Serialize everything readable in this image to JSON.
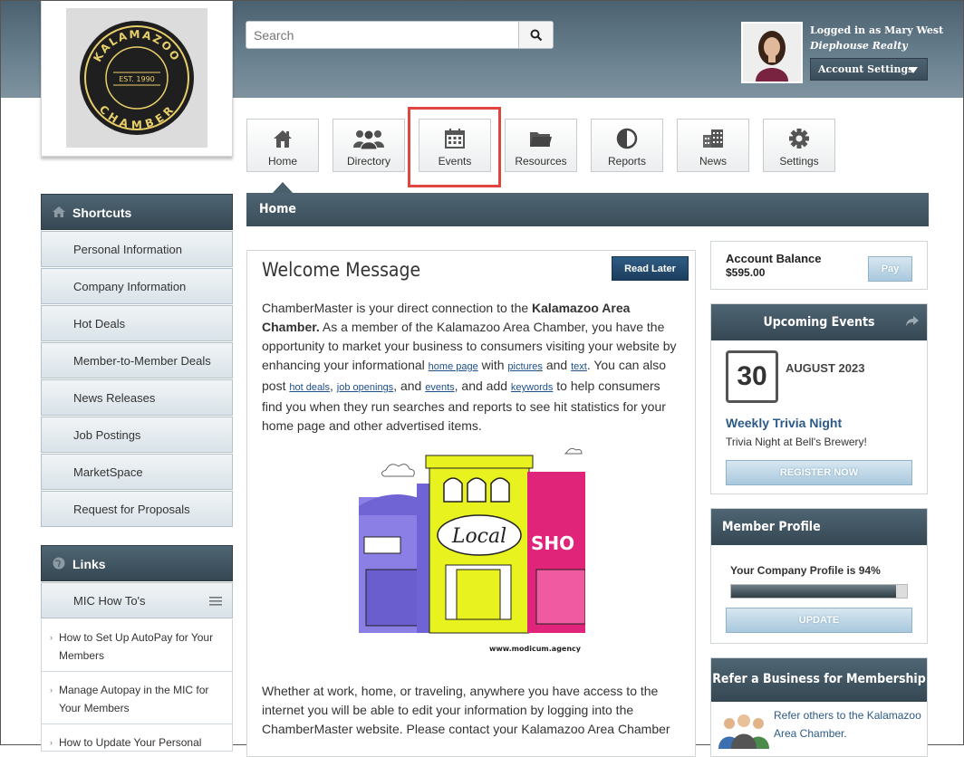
{
  "logo": {
    "ring_text_top": "KALAMAZOO",
    "est": "EST. 1990",
    "ring_text_bottom": "CHAMBER"
  },
  "search": {
    "placeholder": "Search"
  },
  "user": {
    "logged_in_as": "Logged in as Mary West",
    "company": "Diephouse Realty",
    "account_settings": "Account Settings"
  },
  "nav": [
    {
      "label": "Home",
      "icon": "home-icon"
    },
    {
      "label": "Directory",
      "icon": "users-icon"
    },
    {
      "label": "Events",
      "icon": "calendar-icon"
    },
    {
      "label": "Resources",
      "icon": "folder-icon"
    },
    {
      "label": "Reports",
      "icon": "pie-chart-icon"
    },
    {
      "label": "News",
      "icon": "building-icon"
    },
    {
      "label": "Settings",
      "icon": "gear-icon"
    }
  ],
  "page_title": "Home",
  "shortcuts": {
    "title": "Shortcuts",
    "items": [
      "Personal Information",
      "Company Information",
      "Hot Deals",
      "Member-to-Member Deals",
      "News Releases",
      "Job Postings",
      "MarketSpace",
      "Request for Proposals"
    ]
  },
  "links": {
    "title": "Links",
    "group": "MIC How To's",
    "items": [
      "How to Set Up AutoPay for Your Members",
      "Manage Autopay in the MIC for Your Members",
      "How to Update Your Personal"
    ]
  },
  "welcome": {
    "title": "Welcome Message",
    "read_later": "Read Later",
    "p1_a": "ChamberMaster is your direct connection to the ",
    "p1_bold": "Kalamazoo Area Chamber.",
    "p1_b": "  As a member of the Kalamazoo Area Chamber, you have the opportunity to market your business to consumers visiting your website by enhancing your informational ",
    "link_home_page": "home page",
    "t_with": " with ",
    "link_pictures": "pictures",
    "t_and": " and ",
    "link_text": "text",
    "p1_c": ".  You can also post ",
    "link_hot_deals": "hot deals",
    "t_comma": ", ",
    "link_job_openings": "job openings",
    "t_comma_and": ", and ",
    "link_events": "events",
    "t_and_add": ", and add ",
    "link_keywords": "keywords",
    "p1_d": " to help consumers find you when they run searches and reports to see hit statistics for your home page and other advertised items.",
    "illustration_sign": "Local",
    "illustration_shop": "SHO",
    "illustration_url": "www.modicum.agency",
    "p2": "Whether at work, home, or traveling, anywhere you have access to the internet you will be able to edit your information by logging into the ChamberMaster website.  Please contact your Kalamazoo Area Chamber"
  },
  "account": {
    "label": "Account Balance",
    "amount": "$595.00",
    "pay": "Pay"
  },
  "events": {
    "title": "Upcoming Events",
    "day": "30",
    "month_year": "AUGUST 2023",
    "event_title": "Weekly Trivia Night",
    "event_desc": "Trivia Night at Bell's Brewery!",
    "register": "REGISTER NOW"
  },
  "profile": {
    "title": "Member Profile",
    "text": "Your Company Profile is 94%",
    "percent": 94,
    "update": "UPDATE"
  },
  "refer": {
    "title": "Refer a Business for Membership",
    "link": "Refer others to the Kalamazoo Area Chamber."
  },
  "colors": {
    "header": "#4f6573",
    "accent_red": "#e0463f",
    "link": "#1d4f8a",
    "gold": "#e8cf6a"
  }
}
